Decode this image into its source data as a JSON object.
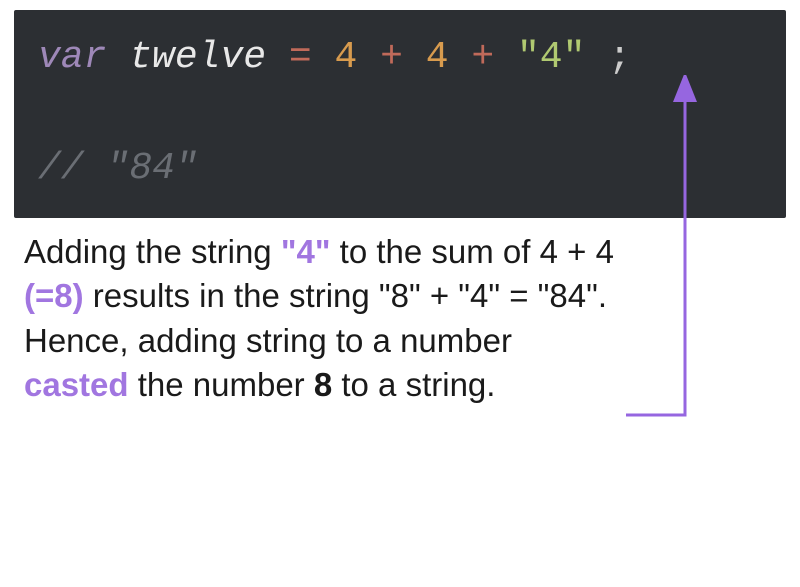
{
  "code": {
    "keyword": "var",
    "varname": "twelve",
    "assign": "=",
    "num1": "4",
    "plus1": "+",
    "num2": "4",
    "plus2": "+",
    "str": "\"4\"",
    "semi": ";",
    "comment": "// \"84\""
  },
  "explain": {
    "p1": "Adding the string ",
    "hl_str": "\"4\"",
    "p2": " to the sum of 4 + 4 ",
    "hl_eq": "(=8)",
    "p3": " results in the string \"8\" + \"4\" = \"84\". Hence, adding string to a number ",
    "hl_casted": "casted",
    "p4": " the number ",
    "hl_eight": "8",
    "p5": " to a string."
  },
  "arrow": {
    "color": "#9666e0"
  }
}
